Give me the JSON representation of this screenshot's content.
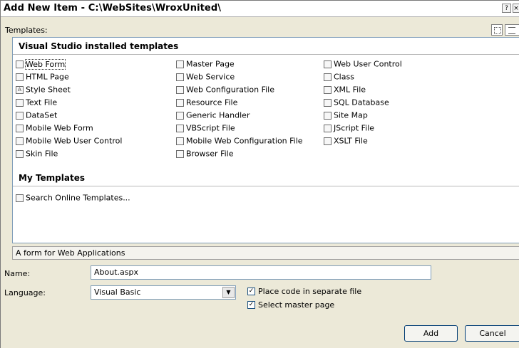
{
  "window": {
    "title": "Add New Item - C:\\WebSites\\WroxUnited\\",
    "help_glyph": "?",
    "close_glyph": "×"
  },
  "templates_label": "Templates:",
  "installed": {
    "title": "Visual Studio installed templates",
    "columns": [
      [
        {
          "label": "Web Form",
          "icon": "web-form-icon",
          "selected": true
        },
        {
          "label": "HTML Page",
          "icon": "html-page-icon"
        },
        {
          "label": "Style Sheet",
          "icon": "style-sheet-icon"
        },
        {
          "label": "Text File",
          "icon": "text-file-icon"
        },
        {
          "label": "DataSet",
          "icon": "dataset-icon"
        },
        {
          "label": "Mobile Web Form",
          "icon": "mobile-web-form-icon"
        },
        {
          "label": "Mobile Web User Control",
          "icon": "mobile-user-control-icon"
        },
        {
          "label": "Skin File",
          "icon": "skin-file-icon"
        }
      ],
      [
        {
          "label": "Master Page",
          "icon": "master-page-icon"
        },
        {
          "label": "Web Service",
          "icon": "web-service-icon"
        },
        {
          "label": "Web Configuration File",
          "icon": "web-config-icon"
        },
        {
          "label": "Resource File",
          "icon": "resource-file-icon"
        },
        {
          "label": "Generic Handler",
          "icon": "generic-handler-icon"
        },
        {
          "label": "VBScript File",
          "icon": "vbscript-file-icon"
        },
        {
          "label": "Mobile Web Configuration File",
          "icon": "mobile-web-config-icon"
        },
        {
          "label": "Browser File",
          "icon": "browser-file-icon"
        }
      ],
      [
        {
          "label": "Web User Control",
          "icon": "web-user-control-icon"
        },
        {
          "label": "Class",
          "icon": "class-icon"
        },
        {
          "label": "XML File",
          "icon": "xml-file-icon"
        },
        {
          "label": "SQL Database",
          "icon": "sql-database-icon"
        },
        {
          "label": "Site Map",
          "icon": "site-map-icon"
        },
        {
          "label": "JScript File",
          "icon": "jscript-file-icon"
        },
        {
          "label": "XSLT File",
          "icon": "xslt-file-icon"
        }
      ]
    ]
  },
  "my_templates": {
    "title": "My Templates",
    "items": [
      {
        "label": "Search Online Templates...",
        "icon": "search-online-icon"
      }
    ]
  },
  "description": "A form for Web Applications",
  "name_label": "Name:",
  "name_value": "About.aspx",
  "language_label": "Language:",
  "language_value": "Visual Basic",
  "options": {
    "place_code": "Place code in separate file",
    "select_master": "Select master page"
  },
  "buttons": {
    "add": "Add",
    "cancel": "Cancel"
  }
}
